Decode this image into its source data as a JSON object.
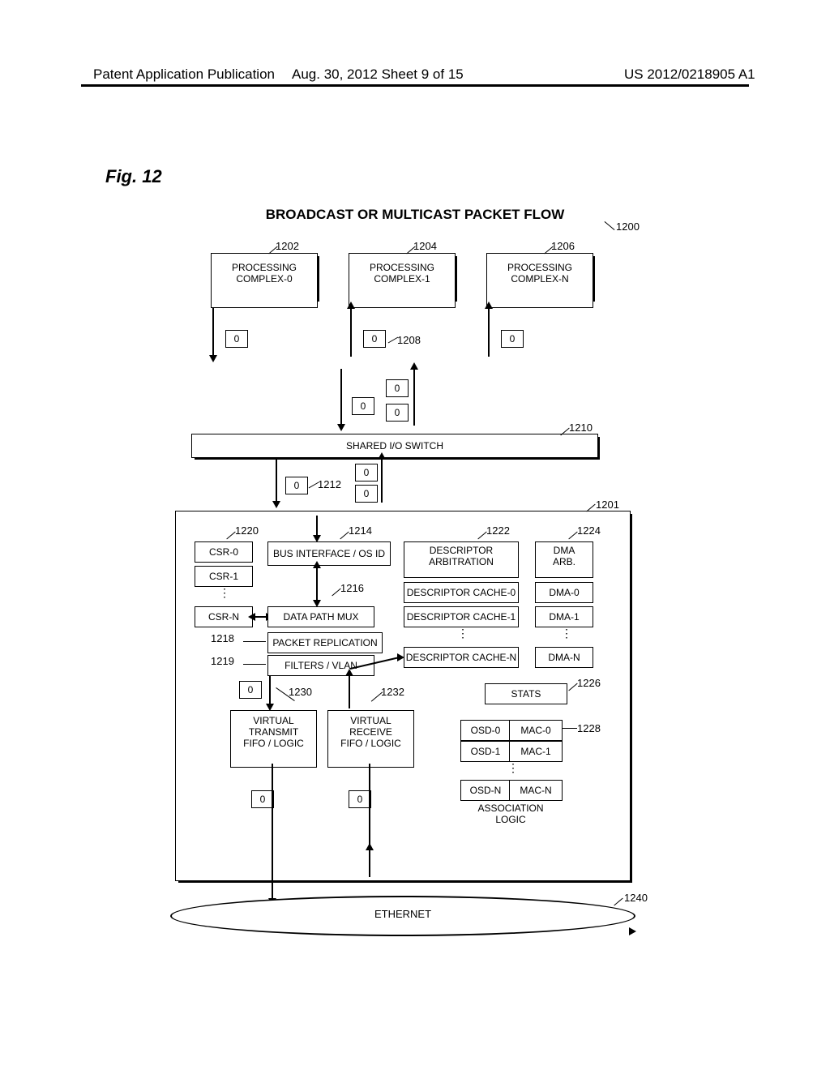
{
  "header": {
    "left": "Patent Application Publication",
    "mid": "Aug. 30, 2012  Sheet 9 of 15",
    "right": "US 2012/0218905 A1"
  },
  "figure_label": "Fig. 12",
  "title": "BROADCAST OR MULTICAST PACKET FLOW",
  "proc": {
    "c0": "PROCESSING\nCOMPLEX-0",
    "c1": "PROCESSING\nCOMPLEX-1",
    "cN": "PROCESSING\nCOMPLEX-N"
  },
  "switch": "SHARED I/O SWITCH",
  "csr": {
    "r0": "CSR-0",
    "r1": "CSR-1",
    "rN": "CSR-N"
  },
  "bus": "BUS INTERFACE / OS ID",
  "dpmux": "DATA PATH MUX",
  "pktrep": "PACKET REPLICATION",
  "filters": "FILTERS / VLAN",
  "descarb": "DESCRIPTOR\nARBITRATION",
  "descc": {
    "d0": "DESCRIPTOR CACHE-0",
    "d1": "DESCRIPTOR CACHE-1",
    "dN": "DESCRIPTOR CACHE-N"
  },
  "dmaarb": "DMA\nARB.",
  "dma": {
    "d0": "DMA-0",
    "d1": "DMA-1",
    "dN": "DMA-N"
  },
  "stats": "STATS",
  "vtx": "VIRTUAL\nTRANSMIT\nFIFO / LOGIC",
  "vrx": "VIRTUAL\nRECEIVE\nFIFO / LOGIC",
  "assoc": {
    "o0": "OSD-0",
    "m0": "MAC-0",
    "o1": "OSD-1",
    "m1": "MAC-1",
    "oN": "OSD-N",
    "mN": "MAC-N",
    "label": "ASSOCIATION\nLOGIC"
  },
  "ethernet": "ETHERNET",
  "packet_label": "0",
  "refs": {
    "r1200": "1200",
    "r1201": "1201",
    "r1202": "1202",
    "r1204": "1204",
    "r1206": "1206",
    "r1208": "1208",
    "r1210": "1210",
    "r1212": "1212",
    "r1214": "1214",
    "r1216": "1216",
    "r1218": "1218",
    "r1219": "1219",
    "r1220": "1220",
    "r1222": "1222",
    "r1224": "1224",
    "r1226": "1226",
    "r1228": "1228",
    "r1230": "1230",
    "r1232": "1232",
    "r1240": "1240"
  }
}
